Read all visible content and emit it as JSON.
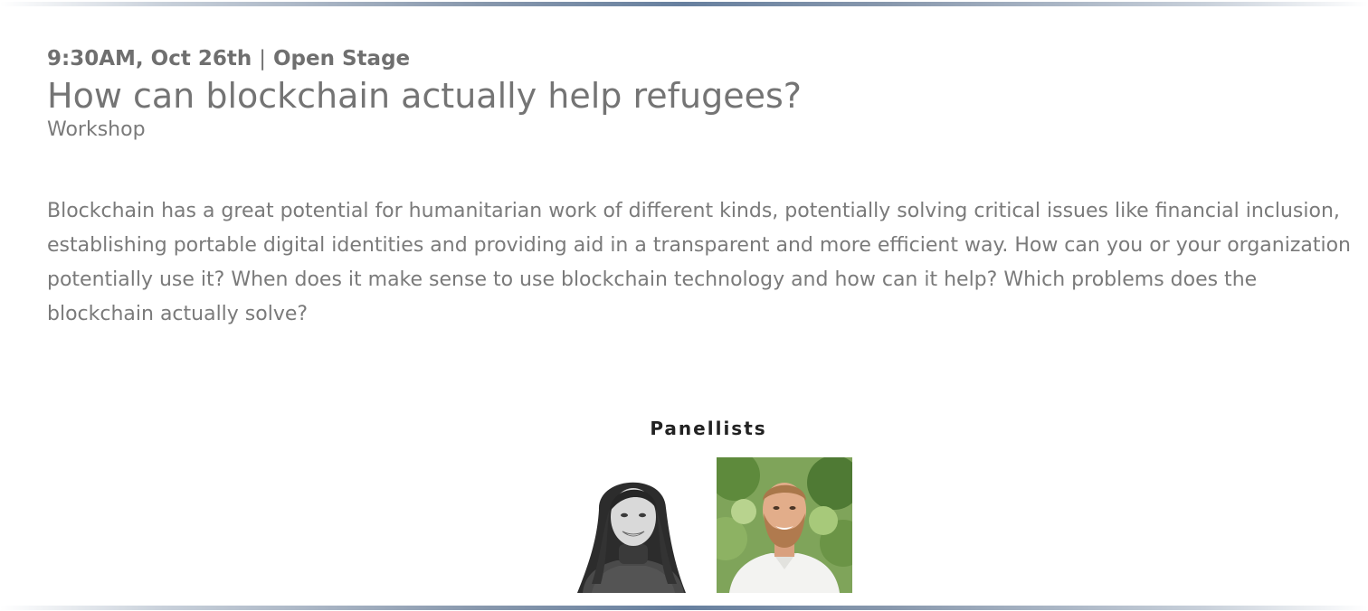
{
  "session": {
    "time": "9:30AM, Oct 26th",
    "separator": "|",
    "stage": "Open Stage",
    "title": "How can blockchain actually help refugees?",
    "type": "Workshop",
    "description_lines": [
      "Blockchain has a great potential for humanitarian work of different kinds, potentially solving critical issues like financial inclusion,",
      "establishing portable digital identities and providing aid in a transparent and more efficient way. How can you or your organization",
      "potentially use it? When does it make sense to use blockchain technology and how can it help? Which problems does the",
      "blockchain actually solve?"
    ]
  },
  "panel": {
    "heading": "Panellists",
    "panellists": [
      {
        "photo_style": "black-and-white portrait",
        "photo_icon": "person-photo"
      },
      {
        "photo_style": "color portrait",
        "photo_icon": "person-photo"
      }
    ]
  }
}
